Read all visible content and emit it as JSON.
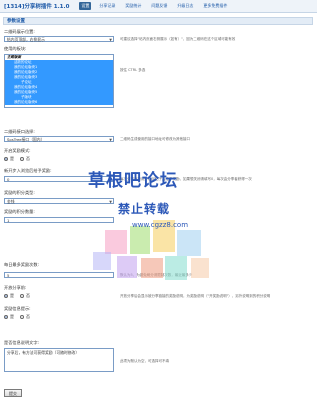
{
  "header": {
    "title": "[1314]分享树插件 1.1.0",
    "nav": [
      "设置",
      "分享记录",
      "奖励统计",
      "问题反馈",
      "升级日志",
      "更多免费插件"
    ],
    "active_nav": 0
  },
  "section": {
    "title": "参数设置"
  },
  "fields": {
    "qr_position": {
      "label": "二维码展示位置:",
      "value": "帖内页顶部，右侧显示",
      "tip": "可建议选择\"帖内页面右侧展示（如有）\"，因为二维码在这个区域可能有效"
    },
    "forums": {
      "label": "使用的板块:",
      "tip": "按住 CTRL 多选",
      "items": [
        "主题版面",
        "活跃的论坛",
        "我的论坛版块1",
        "我的论坛版块2",
        "我的论坛版块3",
        "子论坛",
        "我的论坛版块4",
        "我的论坛版块5",
        "子版块",
        "我的论坛版块6"
      ]
    },
    "qr_api": {
      "label": "二维码接口选择:",
      "value": "SosTree接口（国内）",
      "tip": "二维码生成使用的接口地址可修改为其他接口"
    },
    "reward_mode": {
      "label": "开启奖励模式:",
      "options": [
        "是",
        "否"
      ],
      "selected": 0
    },
    "new_user_reward": {
      "label": "新开步入浏览后给予奖励:",
      "value": "0",
      "tip": "每次分享有新用户访问帖子后给予奖励，如果想关闭请填写0，每次由分享者获得一次"
    },
    "reward_type": {
      "label": "奖励的积分类型:",
      "value": "金钱"
    },
    "reward_amount": {
      "label": "奖励的积分数量:",
      "value": "1"
    },
    "daily_limit": {
      "label": "每日最多奖励次数:",
      "value": "5",
      "tip": "默认为5，为避免刷分请限制次数，最近最多少"
    },
    "show_reward_msg": {
      "label": "开放分享前:",
      "options": [
        "是",
        "否"
      ],
      "selected": 0,
      "tip": "开放分享后会显示被分享链接的奖励说明，为奖励说明（\"开奖励说明\"），另外说明到的积分说明"
    },
    "reward_info": {
      "label": "奖励信息提示:",
      "options": [
        "是",
        "否"
      ],
      "selected": 0
    },
    "share_text": {
      "label": "是否信息说明文字:",
      "value": "分享后，有方法可获得奖励（可随时修改）",
      "tip": "此项为默认为空，可选择可不填"
    }
  },
  "submit_label": "提交",
  "watermark": {
    "line1": "草根吧论坛",
    "line2": "禁止转载",
    "url": "www.cgzz8.com"
  },
  "colors": {
    "accent": "#1e5aa8",
    "selection": "#3399ff",
    "header_bg": "#eef3f9"
  }
}
